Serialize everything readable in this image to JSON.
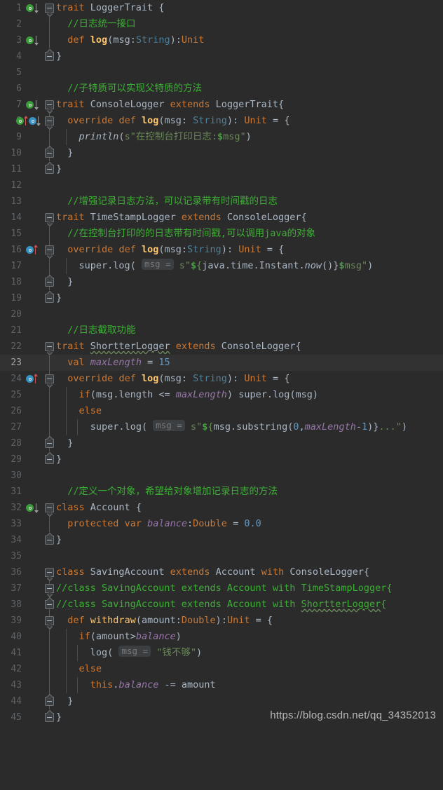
{
  "editor": {
    "theme": "darcula",
    "language": "Scala",
    "background": "#2b2b2b",
    "current_line_background": "#323232",
    "current_line_number": 23,
    "first_line": 1,
    "last_line": 45,
    "total_visible_lines": 45,
    "watermark": "https://blog.csdn.net/qq_34352013",
    "colors": {
      "keyword": "#cc7832",
      "comment": "#3cb034",
      "string": "#6a8759",
      "number": "#6897bb",
      "field": "#9876aa",
      "method": "#ffc66d",
      "type": "#4e8099",
      "default_text": "#a9b7c6",
      "line_number": "#606366",
      "current_line_number": "#a4a3a3",
      "gutter_marker_implemented": "#389c38",
      "gutter_marker_overriding": "#3592c4",
      "gutter_arrow_up": "#c75450",
      "gutter_arrow_down": "#9a9a9a",
      "hint_background": "#3c3f41",
      "hint_text": "#787878"
    }
  },
  "lines": [
    {
      "n": 1,
      "text": "trait LoggerTrait {"
    },
    {
      "n": 2,
      "text": "  //日志统一接口"
    },
    {
      "n": 3,
      "text": "  def log(msg:String):Unit"
    },
    {
      "n": 4,
      "text": "}"
    },
    {
      "n": 5,
      "text": ""
    },
    {
      "n": 6,
      "text": "  //子特质可以实现父特质的方法"
    },
    {
      "n": 7,
      "text": "trait ConsoleLogger extends LoggerTrait{"
    },
    {
      "n": 8,
      "text": "  override def log(msg: String): Unit = {"
    },
    {
      "n": 9,
      "text": "    println(s\"在控制台打印日志:$msg\")"
    },
    {
      "n": 10,
      "text": "  }"
    },
    {
      "n": 11,
      "text": "}"
    },
    {
      "n": 12,
      "text": ""
    },
    {
      "n": 13,
      "text": "  //增强记录日志方法，可以记录带有时间戳的日志"
    },
    {
      "n": 14,
      "text": "trait TimeStampLogger extends ConsoleLogger{"
    },
    {
      "n": 15,
      "text": "  //在控制台打印的的日志带有时间戳,可以调用java的对象"
    },
    {
      "n": 16,
      "text": "  override def log(msg:String): Unit = {"
    },
    {
      "n": 17,
      "text": "    super.log( msg = s\"${java.time.Instant.now()}$msg\")"
    },
    {
      "n": 18,
      "text": "  }"
    },
    {
      "n": 19,
      "text": "}"
    },
    {
      "n": 20,
      "text": ""
    },
    {
      "n": 21,
      "text": "  //日志截取功能"
    },
    {
      "n": 22,
      "text": "trait ShortterLogger extends ConsoleLogger{"
    },
    {
      "n": 23,
      "text": "  val maxLength = 15"
    },
    {
      "n": 24,
      "text": "  override def log(msg: String): Unit = {"
    },
    {
      "n": 25,
      "text": "    if(msg.length <= maxLength) super.log(msg)"
    },
    {
      "n": 26,
      "text": "    else"
    },
    {
      "n": 27,
      "text": "      super.log( msg = s\"${msg.substring(0,maxLength-1)}...\")"
    },
    {
      "n": 28,
      "text": "  }"
    },
    {
      "n": 29,
      "text": "}"
    },
    {
      "n": 30,
      "text": ""
    },
    {
      "n": 31,
      "text": "  //定义一个对象，希望给对象增加记录日志的方法"
    },
    {
      "n": 32,
      "text": "class Account {"
    },
    {
      "n": 33,
      "text": "  protected var balance:Double = 0.0"
    },
    {
      "n": 34,
      "text": "}"
    },
    {
      "n": 35,
      "text": ""
    },
    {
      "n": 36,
      "text": "class SavingAccount extends Account with ConsoleLogger{"
    },
    {
      "n": 37,
      "text": "//class SavingAccount extends Account with TimeStampLogger{"
    },
    {
      "n": 38,
      "text": "//class SavingAccount extends Account with ShortterLogger{"
    },
    {
      "n": 39,
      "text": "  def withdraw(amount:Double):Unit = {"
    },
    {
      "n": 40,
      "text": "    if(amount>balance)"
    },
    {
      "n": 41,
      "text": "      log( msg = \"钱不够\")"
    },
    {
      "n": 42,
      "text": "    else"
    },
    {
      "n": 43,
      "text": "      this.balance -= amount"
    },
    {
      "n": 44,
      "text": "  }"
    },
    {
      "n": 45,
      "text": "}"
    }
  ],
  "gutter_markers": [
    {
      "line": 1,
      "icons": [
        "implemented-marker-green",
        "arrow-down-grey"
      ]
    },
    {
      "line": 3,
      "icons": [
        "implemented-marker-green",
        "arrow-down-grey"
      ]
    },
    {
      "line": 7,
      "icons": [
        "implemented-marker-green",
        "arrow-down-grey"
      ]
    },
    {
      "line": 8,
      "icons": [
        "implementing-marker-green",
        "arrow-up-red",
        "overriding-marker-cyan",
        "arrow-down-grey"
      ]
    },
    {
      "line": 16,
      "icons": [
        "overriding-marker-cyan",
        "arrow-up-red"
      ]
    },
    {
      "line": 24,
      "icons": [
        "overriding-marker-cyan",
        "arrow-up-red"
      ]
    },
    {
      "line": 32,
      "icons": [
        "implemented-marker-green",
        "arrow-down-grey"
      ]
    }
  ],
  "inlay_hints": [
    {
      "line": 17,
      "label": "msg ="
    },
    {
      "line": 27,
      "label": "msg ="
    },
    {
      "line": 41,
      "label": "msg ="
    }
  ],
  "fold_regions": [
    {
      "start": 1,
      "end": 4
    },
    {
      "start": 7,
      "end": 11
    },
    {
      "start": 8,
      "end": 10
    },
    {
      "start": 14,
      "end": 19
    },
    {
      "start": 16,
      "end": 18
    },
    {
      "start": 22,
      "end": 29
    },
    {
      "start": 24,
      "end": 28
    },
    {
      "start": 32,
      "end": 34
    },
    {
      "start": 36,
      "end": 45
    },
    {
      "start": 39,
      "end": 44
    }
  ]
}
